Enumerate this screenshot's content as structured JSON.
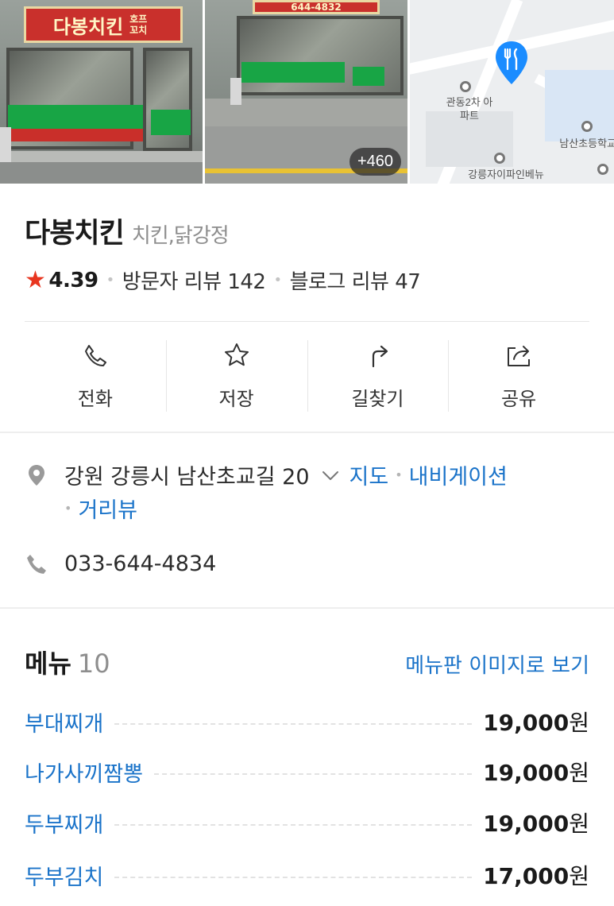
{
  "photos": {
    "more_count": "+460",
    "sign_text": "다봉치킨",
    "sign_sub": "호프 꼬치",
    "sign_phone": "644-4832",
    "banner_text": "다봉치킨"
  },
  "map": {
    "labels": [
      "관동2차 아파트",
      "남산초등학교",
      "강릉자이파인베뉴"
    ]
  },
  "place": {
    "name": "다봉치킨",
    "category": "치킨,닭강정",
    "rating": "4.39",
    "visitor_reviews": "방문자 리뷰 142",
    "blog_reviews": "블로그 리뷰 47"
  },
  "actions": [
    {
      "label": "전화",
      "icon": "phone-icon"
    },
    {
      "label": "저장",
      "icon": "star-outline-icon"
    },
    {
      "label": "길찾기",
      "icon": "directions-icon"
    },
    {
      "label": "공유",
      "icon": "share-icon"
    }
  ],
  "info": {
    "address": "강원 강릉시 남산초교길 20",
    "map_link": "지도",
    "nav_link": "내비게이션",
    "street_link": "거리뷰",
    "phone": "033-644-4834"
  },
  "menu": {
    "title": "메뉴",
    "count": "10",
    "image_link": "메뉴판 이미지로 보기",
    "items": [
      {
        "name": "부대찌개",
        "price": "19,000",
        "unit": "원"
      },
      {
        "name": "나가사끼짬뽕",
        "price": "19,000",
        "unit": "원"
      },
      {
        "name": "두부찌개",
        "price": "19,000",
        "unit": "원"
      },
      {
        "name": "두부김치",
        "price": "17,000",
        "unit": "원"
      }
    ]
  },
  "colors": {
    "link": "#1a73c9",
    "star": "#e8351f",
    "map_pin": "#1a8cff"
  }
}
